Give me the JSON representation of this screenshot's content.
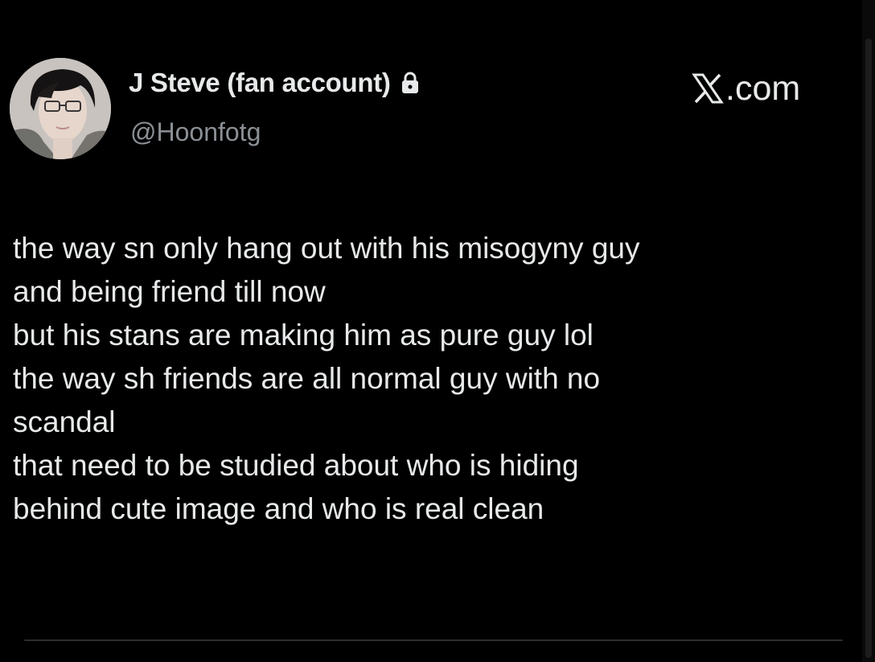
{
  "tweet": {
    "author": {
      "display_name": "J Steve (fan account)",
      "handle": "@Hoonfotg",
      "avatar_icon": "avatar-photo",
      "protected_icon": "lock-icon"
    },
    "brand": {
      "logo_icon": "x-logo-icon",
      "domain_suffix": ".com"
    },
    "body_lines": [
      "the way sn only hang out with his misogyny guy",
      "and being friend till now",
      "but his stans are making him as pure guy lol",
      "the way sh friends are all normal guy with no",
      "scandal",
      "that need to be studied about who is hiding",
      "behind cute image and who is real clean"
    ]
  },
  "colors": {
    "background": "#000000",
    "text": "#e7e9ea",
    "secondary_text": "#8b9096"
  }
}
